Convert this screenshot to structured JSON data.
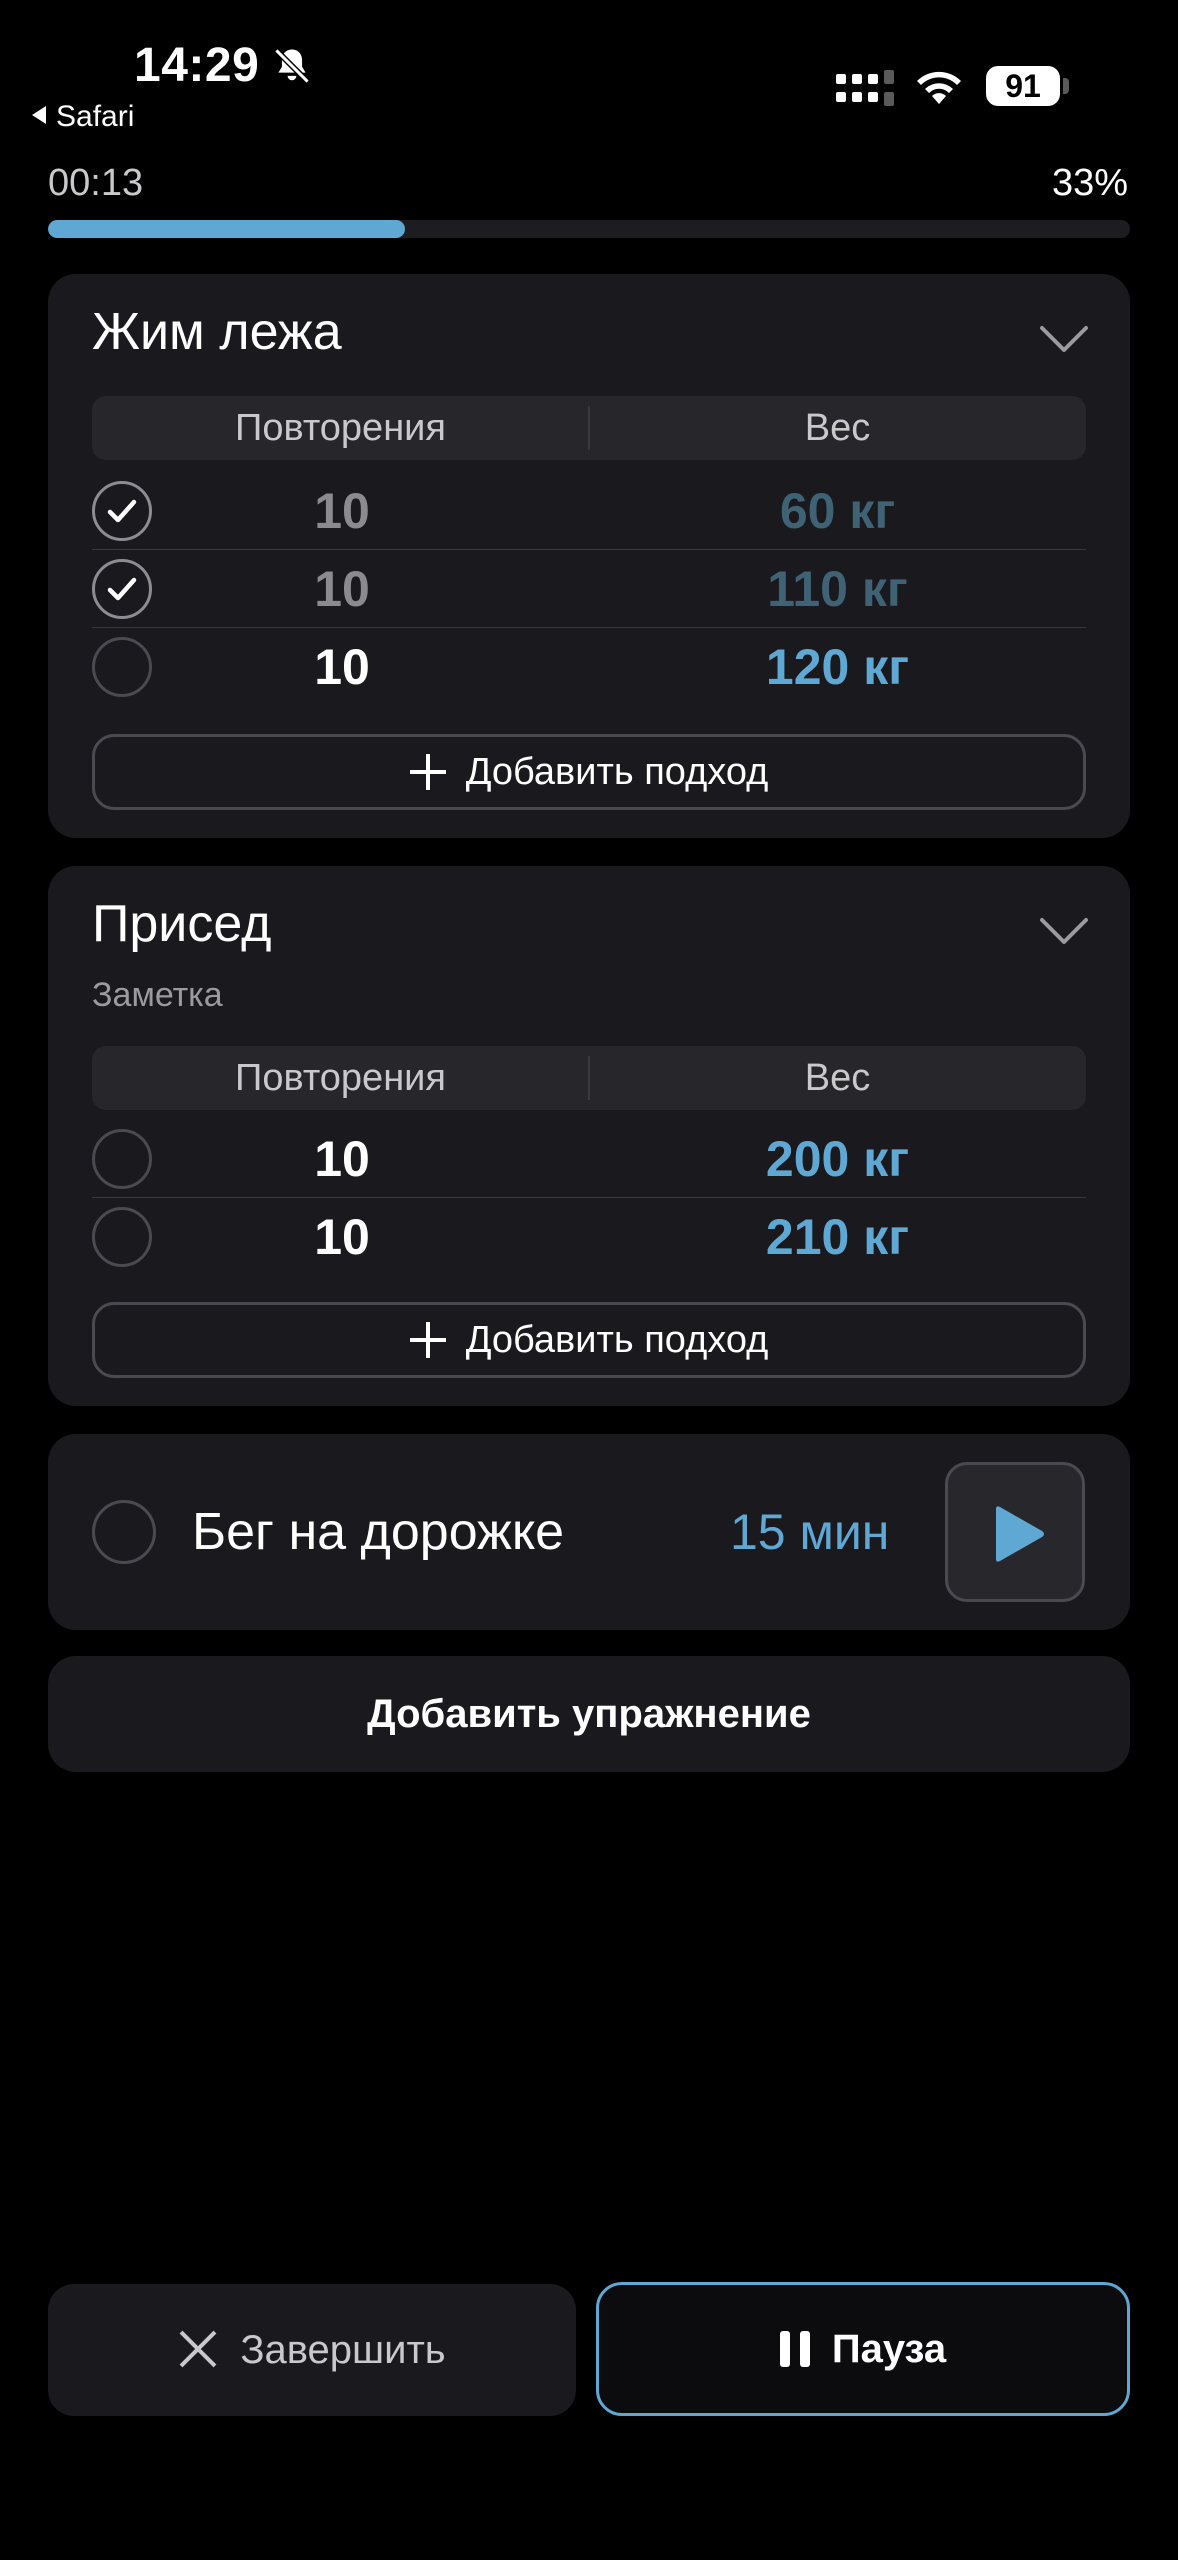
{
  "status_bar": {
    "time": "14:29",
    "back_app": "Safari",
    "battery": "91",
    "bell_icon": "bell-slash-icon",
    "signal_icon": "cellular-signal-icon",
    "wifi_icon": "wifi-icon"
  },
  "progress": {
    "elapsed": "00:13",
    "percent_label": "33%",
    "fraction": 0.33
  },
  "exercises": [
    {
      "title": "Жим лежа",
      "columns": [
        "Повторения",
        "Вес"
      ],
      "sets": [
        {
          "reps": "10",
          "weight": "60 кг",
          "done": true
        },
        {
          "reps": "10",
          "weight": "110 кг",
          "done": true
        },
        {
          "reps": "10",
          "weight": "120 кг",
          "done": false
        }
      ],
      "add_set_label": "Добавить подход"
    },
    {
      "title": "Присед",
      "note": "Заметка",
      "columns": [
        "Повторения",
        "Вес"
      ],
      "sets": [
        {
          "reps": "10",
          "weight": "200 кг",
          "done": false
        },
        {
          "reps": "10",
          "weight": "210 кг",
          "done": false
        }
      ],
      "add_set_label": "Добавить подход"
    }
  ],
  "cardio": {
    "name": "Бег на дорожке",
    "duration": "15 мин"
  },
  "add_exercise_label": "Добавить упражнение",
  "actions": {
    "finish_label": "Завершить",
    "pause_label": "Пауза"
  },
  "colors": {
    "accent": "#5fa8d3",
    "card": "#1a1a1e",
    "background": "#000000"
  }
}
